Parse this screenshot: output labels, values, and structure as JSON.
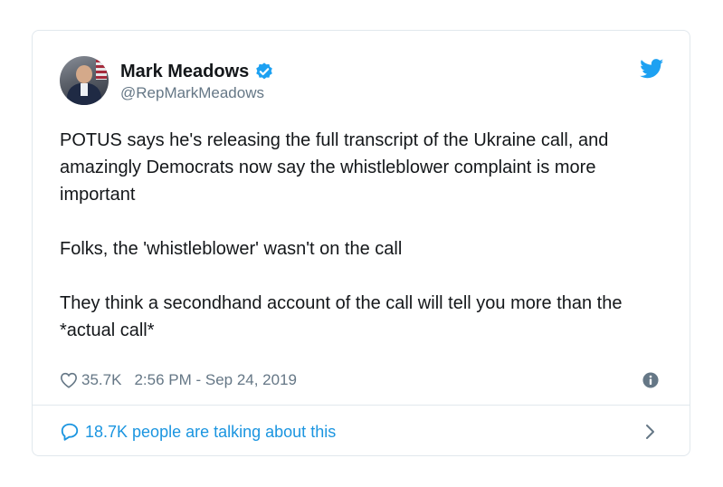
{
  "author": {
    "display_name": "Mark Meadows",
    "handle": "@RepMarkMeadows",
    "verified": true
  },
  "tweet": {
    "paragraphs": [
      "POTUS says he's releasing the full transcript of the Ukraine call, and amazingly Democrats now say the whistleblower complaint is more important",
      "Folks, the 'whistleblower' wasn't on the call",
      "They think a secondhand account of the call will tell you more than the *actual call*"
    ]
  },
  "meta": {
    "likes": "35.7K",
    "timestamp": "2:56 PM - Sep 24, 2019"
  },
  "footer": {
    "talking_text": "18.7K people are talking about this"
  },
  "icons": {
    "brand": "twitter-bird-icon",
    "verified": "verified-badge-icon",
    "like": "heart-icon",
    "info": "info-icon",
    "reply": "speech-bubble-icon",
    "chevron": "chevron-right-icon"
  },
  "colors": {
    "brand_blue": "#1da1f2",
    "link_blue": "#1b95e0",
    "text": "#14171a",
    "secondary_text": "#657786",
    "border": "#e1e8ed"
  }
}
